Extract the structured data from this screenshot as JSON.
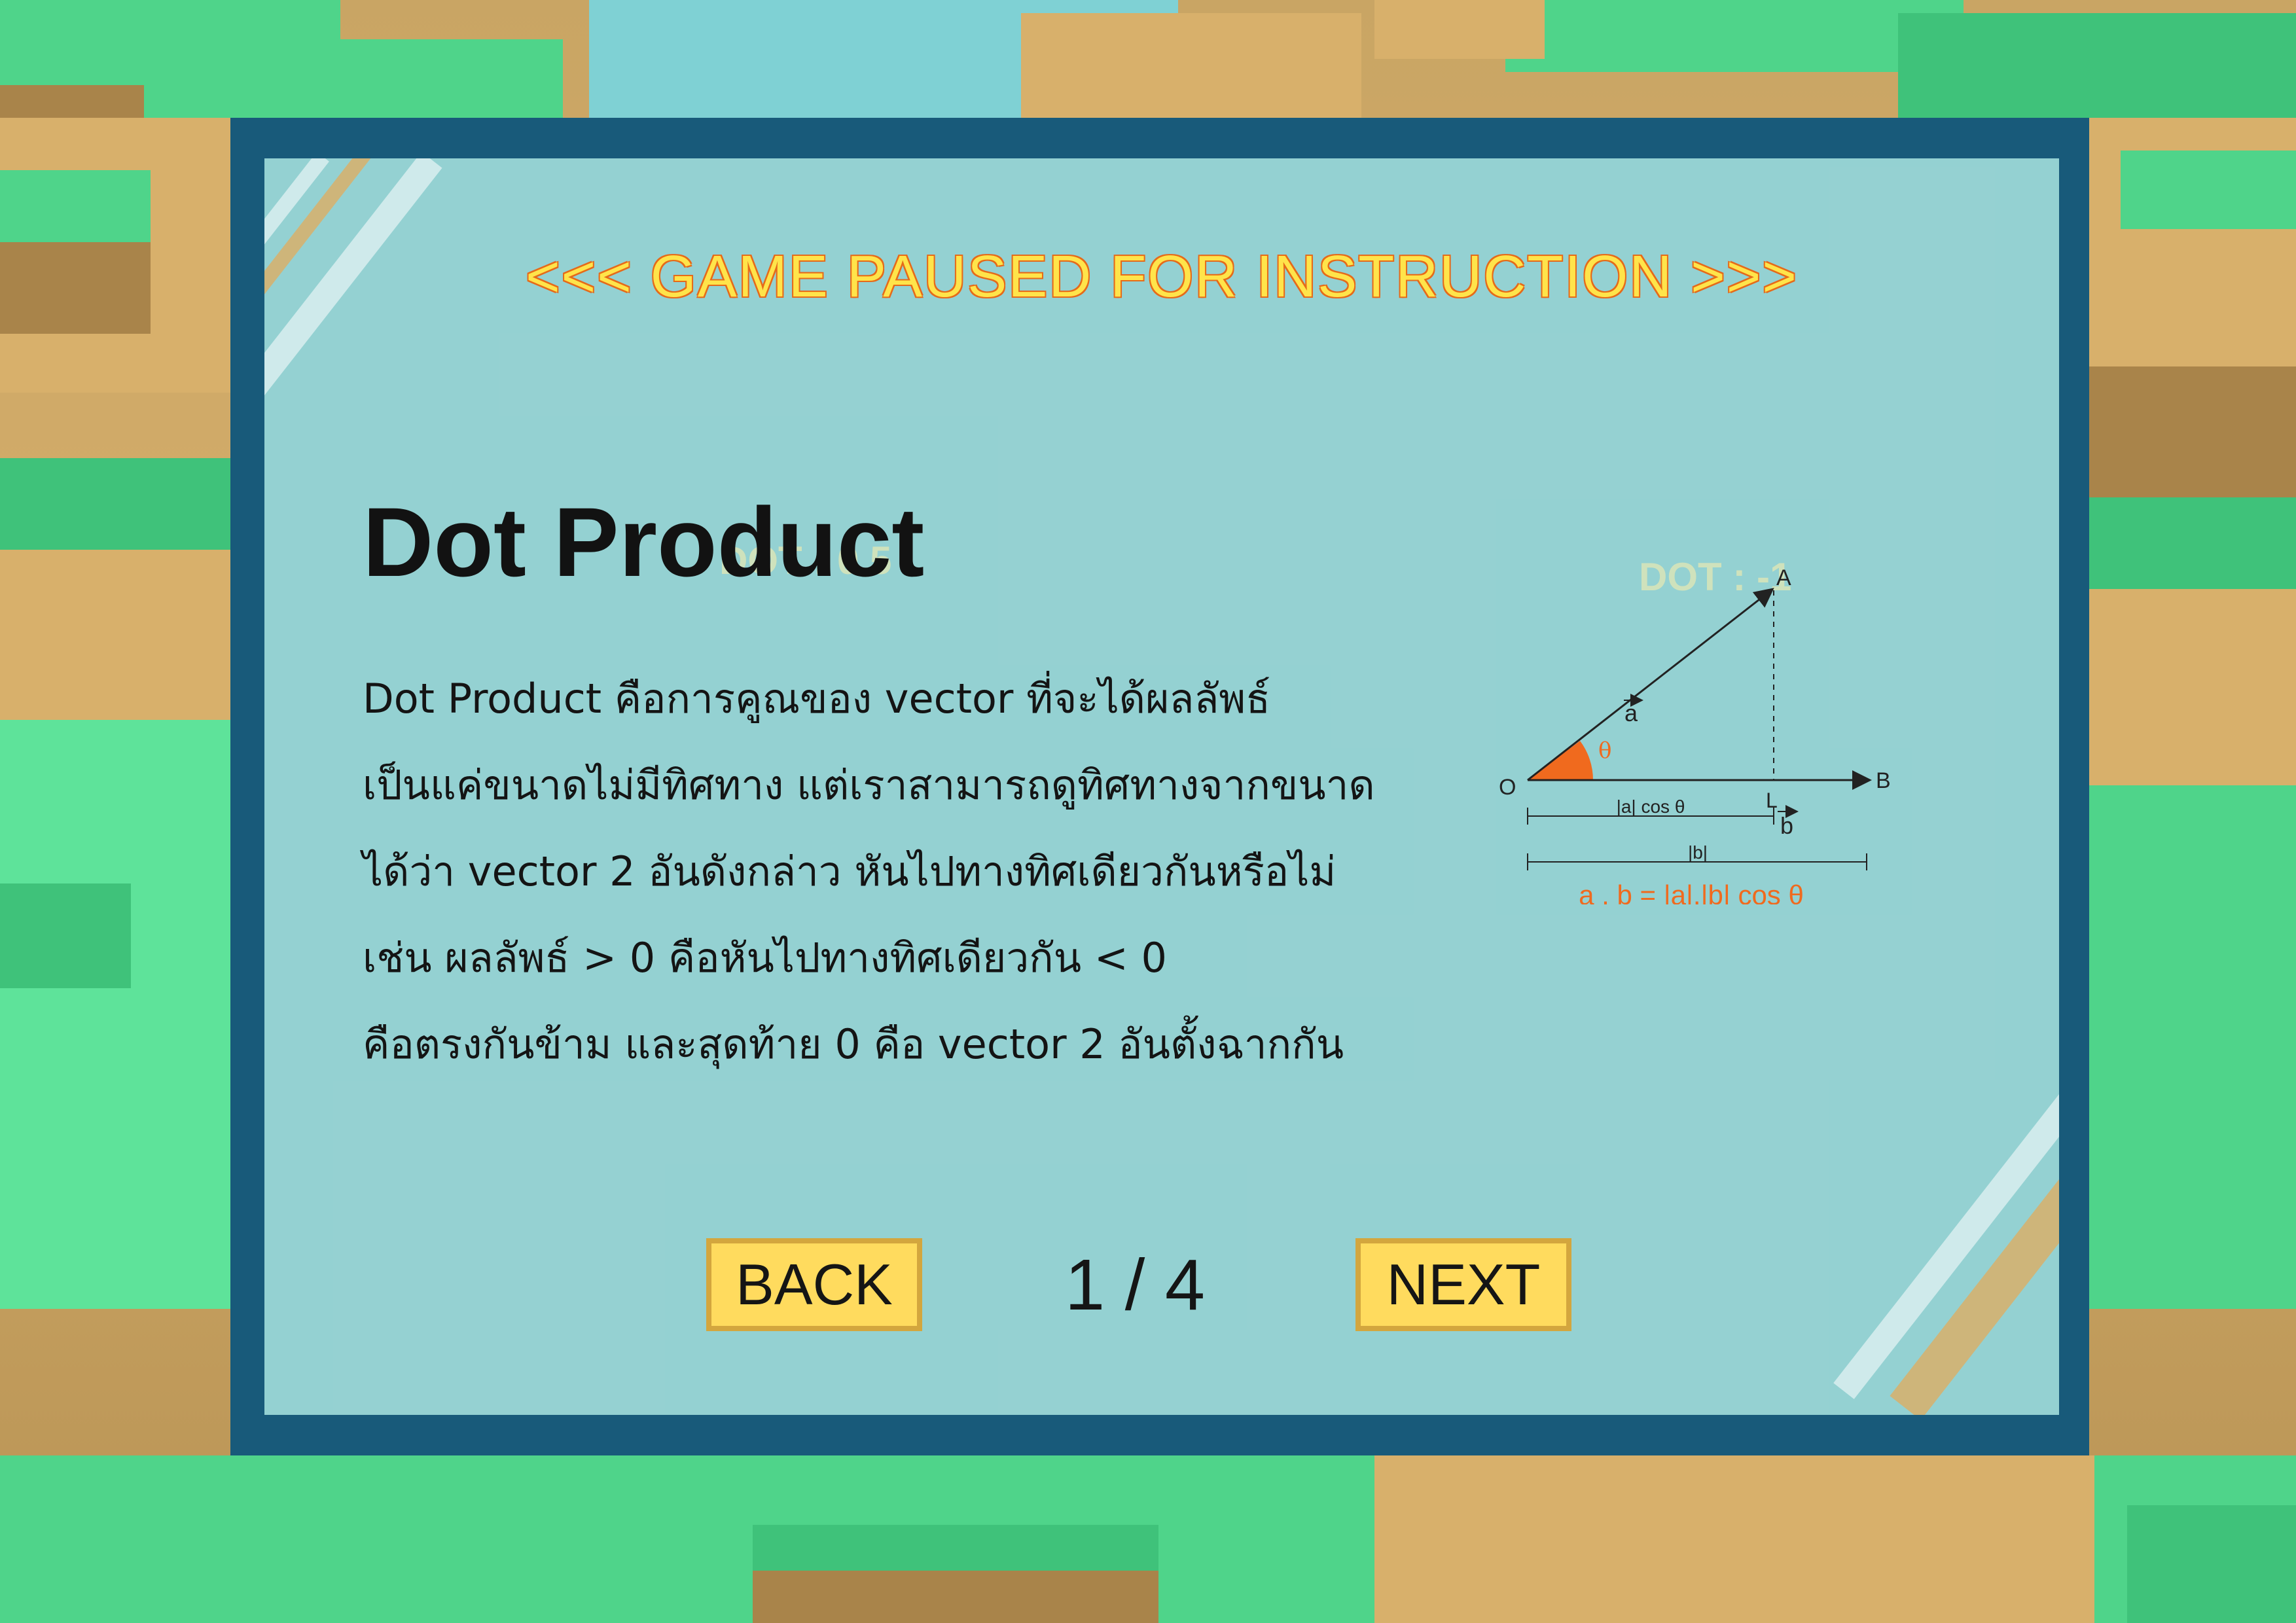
{
  "overlay": {
    "banner": "<<< GAME PAUSED FOR INSTRUCTION >>>",
    "title": "Dot Product",
    "body_lines": [
      "Dot Product คือการคูณของ vector ที่จะได้ผลลัพธ์",
      "เป็นแค่ขนาดไม่มีทิศทาง แต่เราสามารถดูทิศทางจากขนาด",
      "ได้ว่า vector 2 อันดังกล่าว หันไปทางทิศเดียวกันหรือไม่",
      "เช่น ผลลัพธ์ > 0 คือหันไปทางทิศเดียวกัน < 0",
      "คือตรงกันข้าม และสุดท้าย 0 คือ vector 2 อันตั้งฉากกัน"
    ],
    "background_labels": [
      "DOT : 0.5",
      "DOT : -1"
    ]
  },
  "diagram": {
    "point_a": "A",
    "point_b": "B",
    "point_o": "O",
    "point_l": "L",
    "vector_a": "a",
    "vector_b": "b",
    "angle": "θ",
    "projection_label": "|a| cos θ",
    "length_b_label": "|b|",
    "formula": "a . b = |a|.|b| cos θ"
  },
  "navigation": {
    "back_label": "BACK",
    "next_label": "NEXT",
    "page": "1 / 4"
  },
  "colors": {
    "panel_border": "#185a7a",
    "panel_fill": "#b0ebe5",
    "banner_text": "#ffe44a",
    "banner_outline": "#e66b1a",
    "button_fill": "#ffdb5e",
    "button_border": "#d3a63e",
    "diagram_accent": "#f06a1e"
  }
}
